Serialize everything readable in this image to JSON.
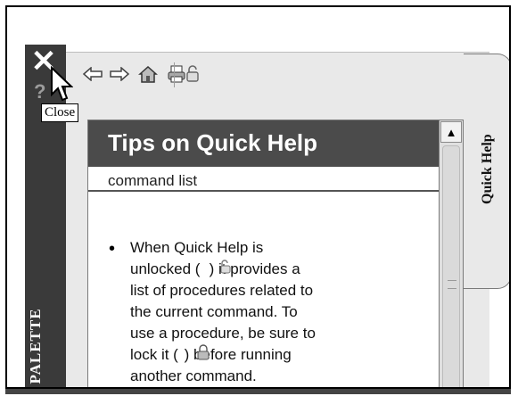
{
  "tooltip": {
    "text": "Close"
  },
  "palette": {
    "vertical_title": "O PALETTE",
    "side_tab_label": "Quick Help"
  },
  "toolbar": {
    "buttons": [
      "back-icon",
      "forward-icon",
      "home-icon",
      "print-icon",
      "lock-toggle-icon"
    ]
  },
  "content": {
    "title": "Tips on Quick Help",
    "subtitle": "command list",
    "tip_lines": [
      "When Quick Help is",
      "unlocked (   ) it provides a",
      "list of procedures related to",
      "the current command. To",
      "use a procedure, be sure to",
      "lock it (  ) before running",
      "another command."
    ]
  }
}
